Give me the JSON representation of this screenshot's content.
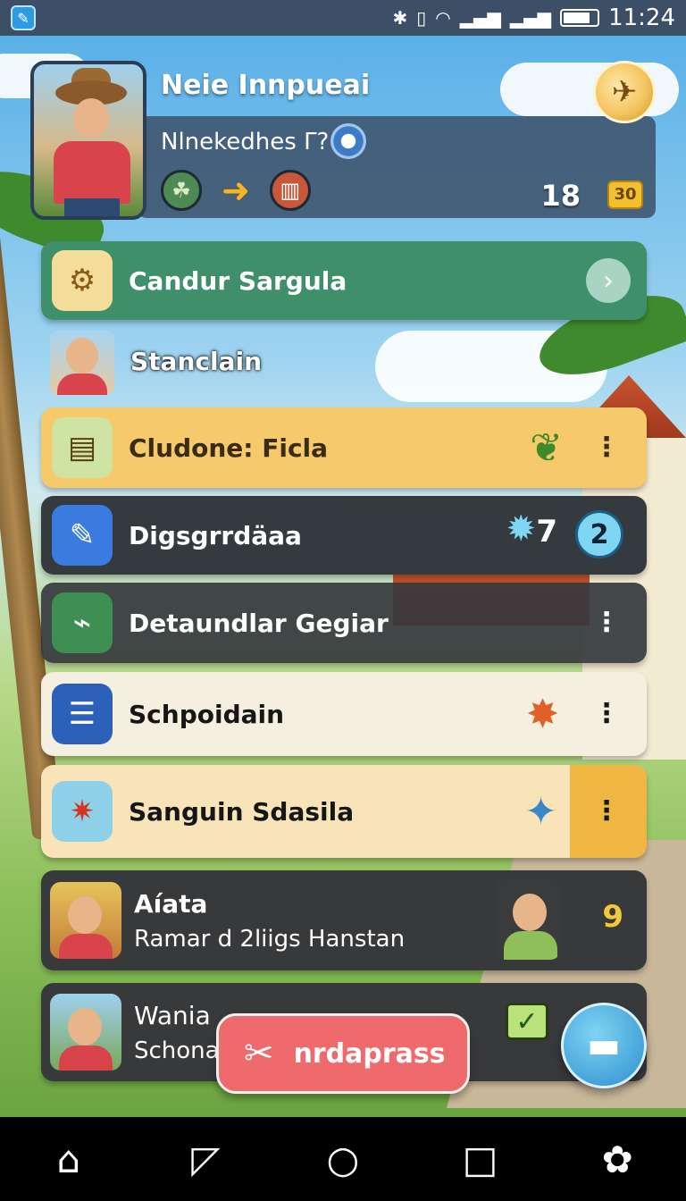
{
  "status_bar": {
    "app_icon": "game-app-icon",
    "icons": [
      "bluetooth-icon",
      "nfc-icon",
      "wifi-icon",
      "signal-icon",
      "signal-4g-icon"
    ],
    "battery_level": 0.8,
    "time": "11:24"
  },
  "profile": {
    "name": "Neie Innpueai",
    "subtitle": "Nlnekedhes Γ?",
    "score": "18",
    "coin": "30",
    "badges": [
      "palm-badge-icon",
      "arrow-right-icon",
      "chest-badge-icon"
    ]
  },
  "list": {
    "featured": {
      "label": "Candur Sargula"
    },
    "section_header": "Stanclain",
    "items": [
      {
        "label": "Cludone: Ficla",
        "icon": "planter-icon",
        "deco": "leaf-icon"
      },
      {
        "label": "Digsgrrdäaa",
        "icon": "edit-note-icon",
        "count": "7",
        "badge": "2"
      },
      {
        "label": "Detaundlar Gegiar",
        "icon": "tag-icon"
      },
      {
        "label": "Schpoidain",
        "icon": "document-icon",
        "deco": "sale-burst-icon"
      },
      {
        "label": "Sanguin Sdasila",
        "icon": "star-burst-icon",
        "deco": "blue-arrow-icon"
      }
    ],
    "contacts": [
      {
        "name": "Aíata",
        "message": "Ramar d 2liigs Hanstan",
        "badge": "9"
      },
      {
        "name": "Wania",
        "message": "Schonai"
      }
    ]
  },
  "fab": {
    "label": "nrdaprass"
  },
  "colors": {
    "status_bar": "#3d4f66",
    "featured_row": "#3f8f6a",
    "accent_yellow": "#f6c96a",
    "fab_pill": "#ee6a6c",
    "fab_round": "#2e8fd0"
  }
}
